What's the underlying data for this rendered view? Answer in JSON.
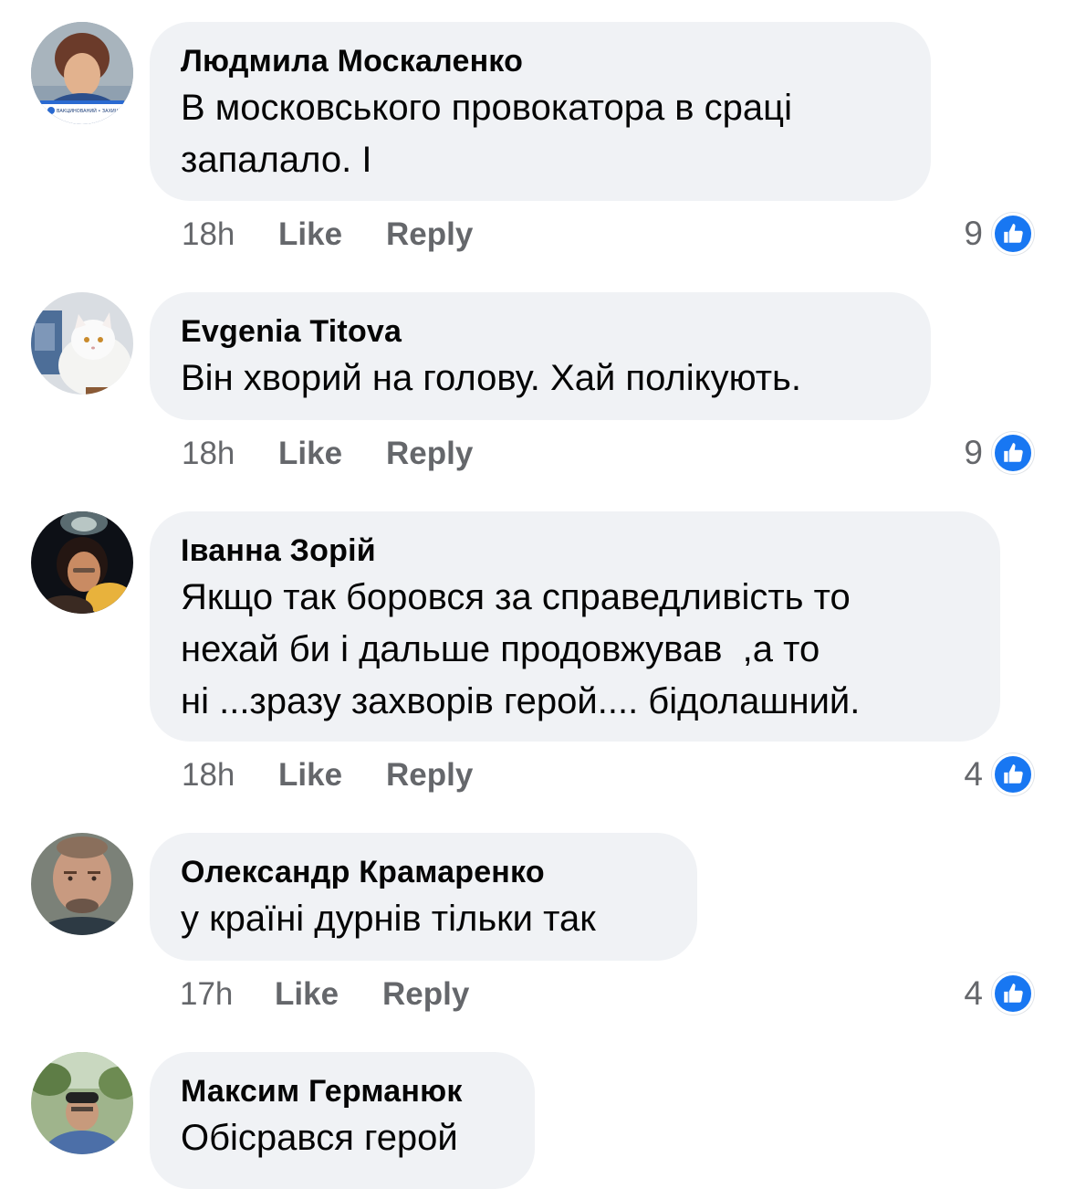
{
  "comments": [
    {
      "author": "Людмила Москаленко",
      "text": "В московського провокатора в сраці\nзапалало. І",
      "time": "18h",
      "like_label": "Like",
      "reply_label": "Reply",
      "reaction_count": "9",
      "avatar_caption": "ВАКЦИНОВАНИЙ • ЗАХИЩЕНИЙ"
    },
    {
      "author": "Evgenia  Titova",
      "text": "Він хворий на голову. Хай полікують.",
      "time": "18h",
      "like_label": "Like",
      "reply_label": "Reply",
      "reaction_count": "9"
    },
    {
      "author": "Іванна Зорій",
      "text": "Якщо так боровся за справедливість то\nнехай би і дальше продовжував  ,а то\nні ...зразу захворів герой.... бідолашний.",
      "time": "18h",
      "like_label": "Like",
      "reply_label": "Reply",
      "reaction_count": "4"
    },
    {
      "author": "Олександр Крамаренко",
      "text": "у країні дурнів тільки так",
      "time": "17h",
      "like_label": "Like",
      "reply_label": "Reply",
      "reaction_count": "4"
    },
    {
      "author": "Максим Германюк",
      "text": "Обісрався герой"
    }
  ],
  "colors": {
    "bubble": "#f0f2f5",
    "meta_text": "#65676b",
    "like_blue": "#1877f2"
  },
  "icons": {
    "reaction": "thumbs-up-icon"
  }
}
